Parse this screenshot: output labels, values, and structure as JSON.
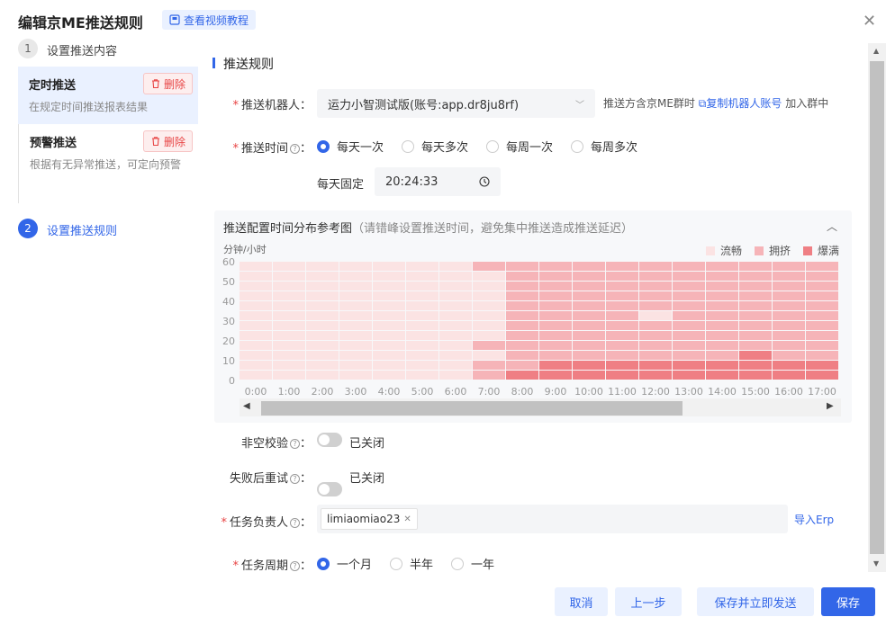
{
  "header": {
    "title": "编辑京ME推送规则",
    "video_label": "查看视频教程"
  },
  "steps": [
    {
      "num": "1",
      "label": "设置推送内容"
    },
    {
      "num": "2",
      "label": "设置推送规则"
    }
  ],
  "cards": [
    {
      "title": "定时推送",
      "desc": "在规定时间推送报表结果",
      "delete_label": "删除"
    },
    {
      "title": "预警推送",
      "desc": "根据有无异常推送，可定向预警",
      "delete_label": "删除"
    }
  ],
  "form": {
    "section_title": "推送规则",
    "robot_label": "推送机器人：",
    "robot_value": "运力小智测试版(账号:app.dr8ju8rf)",
    "robot_hint_prefix": "推送方含京ME群时",
    "robot_hint_link": "复制机器人账号",
    "robot_hint_suffix": "加入群中",
    "time_label": "推送时间",
    "time_options": [
      "每天一次",
      "每天多次",
      "每周一次",
      "每周多次"
    ],
    "time_selected": 0,
    "fixed_label": "每天固定",
    "fixed_time": "20:24:33",
    "nonempty_label": "非空校验",
    "nonempty_state": "已关闭",
    "retry_label": "失败后重试",
    "retry_state": "已关闭",
    "owner_label": "任务负责人",
    "owner_tag": "limiaomiao23",
    "owner_import": "导入Erp",
    "period_label": "任务周期",
    "period_options": [
      "一个月",
      "半年",
      "一年"
    ],
    "period_selected": 0
  },
  "chart_data": {
    "type": "heatmap",
    "title": "推送配置时间分布参考图",
    "subtitle": "（请错峰设置推送时间，避免集中推送造成推送延迟）",
    "ylabel": "分钟/小时",
    "x": [
      "0:00",
      "1:00",
      "2:00",
      "3:00",
      "4:00",
      "5:00",
      "6:00",
      "7:00",
      "8:00",
      "9:00",
      "10:00",
      "11:00",
      "12:00",
      "13:00",
      "14:00",
      "15:00",
      "16:00",
      "17:00"
    ],
    "y": [
      60,
      50,
      40,
      30,
      20,
      10,
      0
    ],
    "ylim": [
      0,
      60
    ],
    "legend": [
      {
        "name": "流畅",
        "color": "#fbe3e3"
      },
      {
        "name": "拥挤",
        "color": "#f6b4b8"
      },
      {
        "name": "爆满",
        "color": "#ef7f84"
      }
    ],
    "levels_note": "0=流畅 1=拥挤 2=爆满; rows top(55-60) to bottom(0-5), 2 rows per 10 min",
    "grid": [
      [
        0,
        0,
        0,
        0,
        0,
        0,
        0,
        1,
        1,
        1,
        1,
        1,
        1,
        1,
        1,
        1,
        1,
        1
      ],
      [
        0,
        0,
        0,
        0,
        0,
        0,
        0,
        0,
        1,
        1,
        1,
        1,
        1,
        1,
        1,
        1,
        1,
        1
      ],
      [
        0,
        0,
        0,
        0,
        0,
        0,
        0,
        0,
        1,
        1,
        1,
        1,
        1,
        1,
        1,
        1,
        1,
        1
      ],
      [
        0,
        0,
        0,
        0,
        0,
        0,
        0,
        0,
        1,
        1,
        1,
        1,
        1,
        1,
        1,
        1,
        1,
        1
      ],
      [
        0,
        0,
        0,
        0,
        0,
        0,
        0,
        0,
        1,
        1,
        1,
        1,
        1,
        1,
        1,
        1,
        1,
        1
      ],
      [
        0,
        0,
        0,
        0,
        0,
        0,
        0,
        0,
        1,
        1,
        1,
        1,
        0,
        1,
        1,
        1,
        1,
        1
      ],
      [
        0,
        0,
        0,
        0,
        0,
        0,
        0,
        0,
        1,
        1,
        1,
        1,
        1,
        1,
        1,
        1,
        1,
        1
      ],
      [
        0,
        0,
        0,
        0,
        0,
        0,
        0,
        0,
        1,
        1,
        1,
        1,
        1,
        1,
        1,
        1,
        1,
        1
      ],
      [
        0,
        0,
        0,
        0,
        0,
        0,
        0,
        1,
        1,
        1,
        1,
        1,
        1,
        1,
        1,
        1,
        1,
        1
      ],
      [
        0,
        0,
        0,
        0,
        0,
        0,
        0,
        0,
        1,
        1,
        1,
        1,
        1,
        1,
        1,
        2,
        1,
        1
      ],
      [
        0,
        0,
        0,
        0,
        0,
        0,
        0,
        1,
        1,
        2,
        2,
        2,
        2,
        2,
        2,
        2,
        2,
        2
      ],
      [
        0,
        0,
        0,
        0,
        0,
        0,
        0,
        1,
        2,
        2,
        2,
        2,
        2,
        2,
        2,
        2,
        2,
        2
      ]
    ]
  },
  "footer": {
    "cancel": "取消",
    "prev": "上一步",
    "save_send": "保存并立即发送",
    "save": "保存"
  },
  "colors": {
    "primary": "#3266e8",
    "danger": "#e84545"
  }
}
